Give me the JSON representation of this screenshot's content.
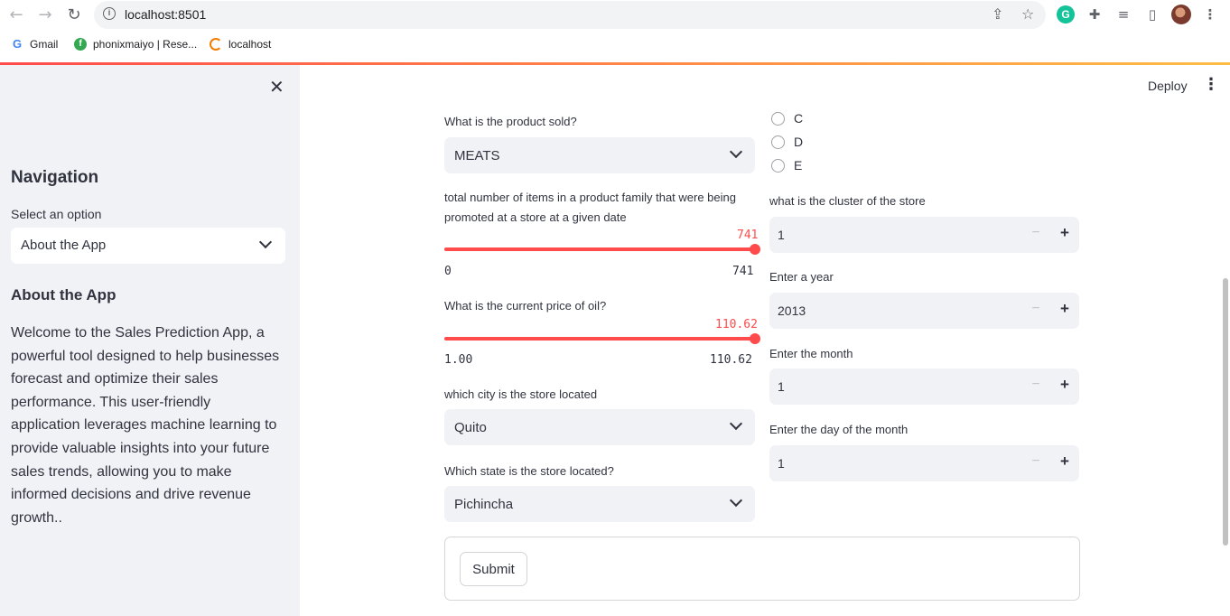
{
  "browser": {
    "url": "localhost:8501",
    "bookmarks": [
      {
        "label": "Gmail"
      },
      {
        "label": "phonixmaiyo | Rese..."
      },
      {
        "label": "localhost"
      }
    ]
  },
  "header": {
    "deploy_label": "Deploy"
  },
  "sidebar": {
    "nav_heading": "Navigation",
    "select_label": "Select an option",
    "select_value": "About the App",
    "about_heading": "About the App",
    "about_text": "Welcome to the Sales Prediction App, a powerful tool designed to help businesses forecast and optimize their sales performance. This user-friendly application leverages machine learning to provide valuable insights into your future sales trends, allowing you to make informed decisions and drive revenue growth.."
  },
  "form": {
    "product": {
      "label": "What is the product sold?",
      "value": "MEATS"
    },
    "promo": {
      "label": "total number of items in a product family that were being promoted at a store at a given date",
      "value": "741",
      "min": "0",
      "max": "741",
      "fraction": 1.0
    },
    "oil": {
      "label": "What is the current price of oil?",
      "value": "110.62",
      "min": "1.00",
      "max": "110.62",
      "fraction": 1.0
    },
    "city": {
      "label": "which city is the store located",
      "value": "Quito"
    },
    "state": {
      "label": "Which state is the store located?",
      "value": "Pichincha"
    },
    "store_type_options": [
      "C",
      "D",
      "E"
    ],
    "cluster": {
      "label": "what is the cluster of the store",
      "value": "1"
    },
    "year": {
      "label": "Enter a year",
      "value": "2013"
    },
    "month": {
      "label": "Enter the month",
      "value": "1"
    },
    "day": {
      "label": "Enter the day of the month",
      "value": "1"
    },
    "stepper_minus": "−",
    "stepper_plus": "+",
    "submit_label": "Submit"
  },
  "colors": {
    "accent": "#ff4b4b",
    "sidebar_bg": "#f0f2f6",
    "text": "#31333f"
  }
}
